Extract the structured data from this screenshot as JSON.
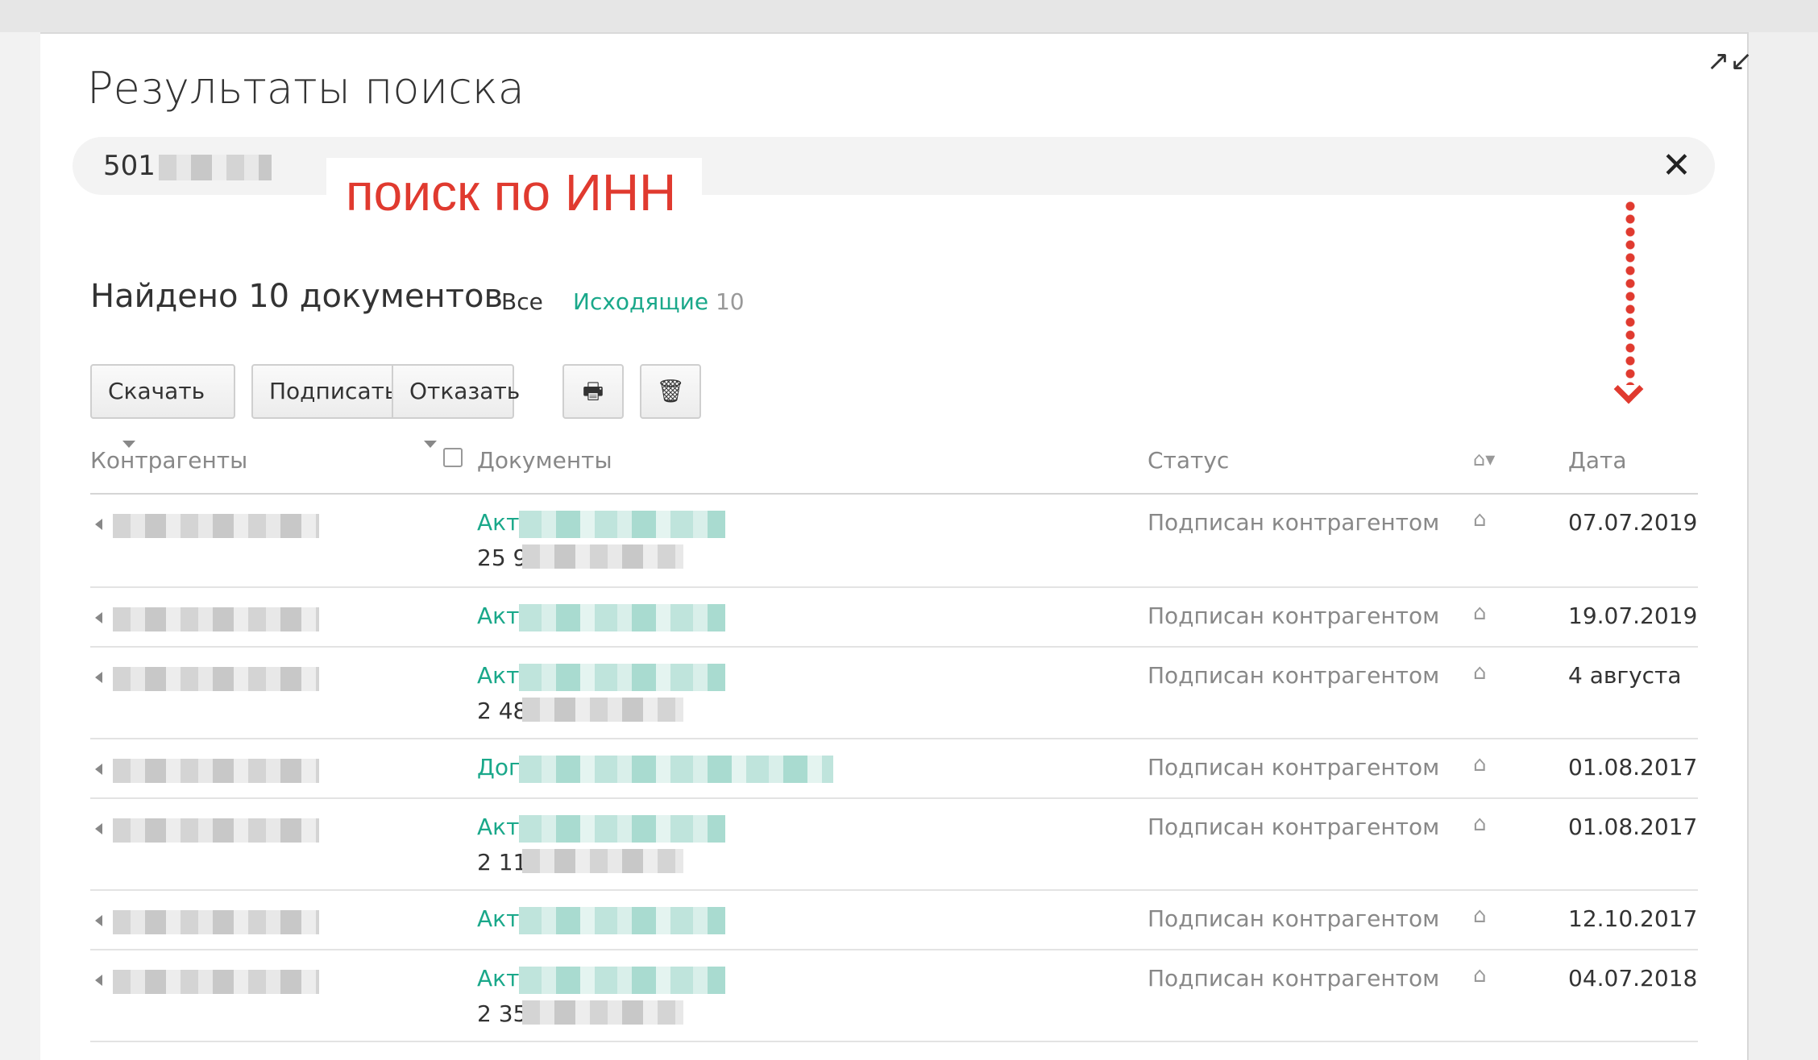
{
  "panel": {
    "title": "Результаты поиска",
    "expand_icon": "↗↙",
    "search": {
      "value": "501",
      "clear_icon": "✕"
    },
    "annotation": "поиск по ИНН"
  },
  "results": {
    "found_text": "Найдено 10 документов",
    "filters": {
      "all": "Все",
      "outgoing": "Исходящие",
      "outgoing_count": "10"
    }
  },
  "toolbar": {
    "download": "Скачать",
    "sign": "Подписать",
    "reject": "Отказать",
    "print_icon": "🖶",
    "delete_icon": "🗑"
  },
  "table": {
    "headers": {
      "counterparty": "Контрагенты",
      "documents": "Документы",
      "status": "Статус",
      "date": "Дата"
    },
    "home_icon": "⌂",
    "rows": [
      {
        "doc_type": "Акт",
        "amount": "25 9",
        "status": "Подписан контрагентом",
        "date": "07.07.2019"
      },
      {
        "doc_type": "Акт",
        "amount": "",
        "status": "Подписан контрагентом",
        "date": "19.07.2019"
      },
      {
        "doc_type": "Акт",
        "amount": "2 48",
        "status": "Подписан контрагентом",
        "date": "4 августа"
      },
      {
        "doc_type": "Дого",
        "amount": "",
        "status": "Подписан контрагентом",
        "date": "01.08.2017"
      },
      {
        "doc_type": "Акт",
        "amount": "2 11",
        "status": "Подписан контрагентом",
        "date": "01.08.2017"
      },
      {
        "doc_type": "Акт",
        "amount": "",
        "status": "Подписан контрагентом",
        "date": "12.10.2017"
      },
      {
        "doc_type": "Акт",
        "amount": "2 35",
        "status": "Подписан контрагентом",
        "date": "04.07.2018"
      }
    ]
  }
}
